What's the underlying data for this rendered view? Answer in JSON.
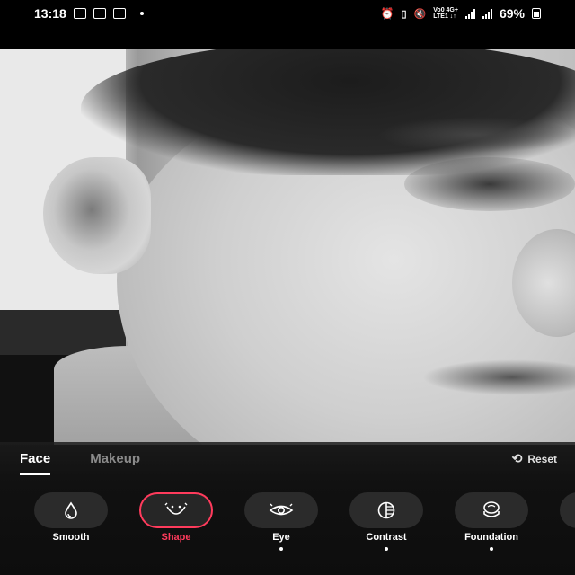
{
  "status_bar": {
    "time": "13:18",
    "battery": "69%",
    "network_top": "Vo0 4G+",
    "network_bottom": "LTE1 ↓↑"
  },
  "tabs": [
    {
      "label": "Face",
      "active": true
    },
    {
      "label": "Makeup",
      "active": false
    }
  ],
  "reset_label": "Reset",
  "tools": [
    {
      "label": "Smooth",
      "icon": "drop-icon",
      "selected": false,
      "dot": false
    },
    {
      "label": "Shape",
      "icon": "face-shape-icon",
      "selected": true,
      "dot": false
    },
    {
      "label": "Eye",
      "icon": "eye-icon",
      "selected": false,
      "dot": true
    },
    {
      "label": "Contrast",
      "icon": "contrast-icon",
      "selected": false,
      "dot": true
    },
    {
      "label": "Foundation",
      "icon": "foundation-icon",
      "selected": false,
      "dot": true
    },
    {
      "label": "",
      "icon": "more-icon",
      "selected": false,
      "dot": false
    }
  ],
  "colors": {
    "accent": "#ff3b5c",
    "panel": "#111111",
    "button": "#2b2b2b"
  }
}
